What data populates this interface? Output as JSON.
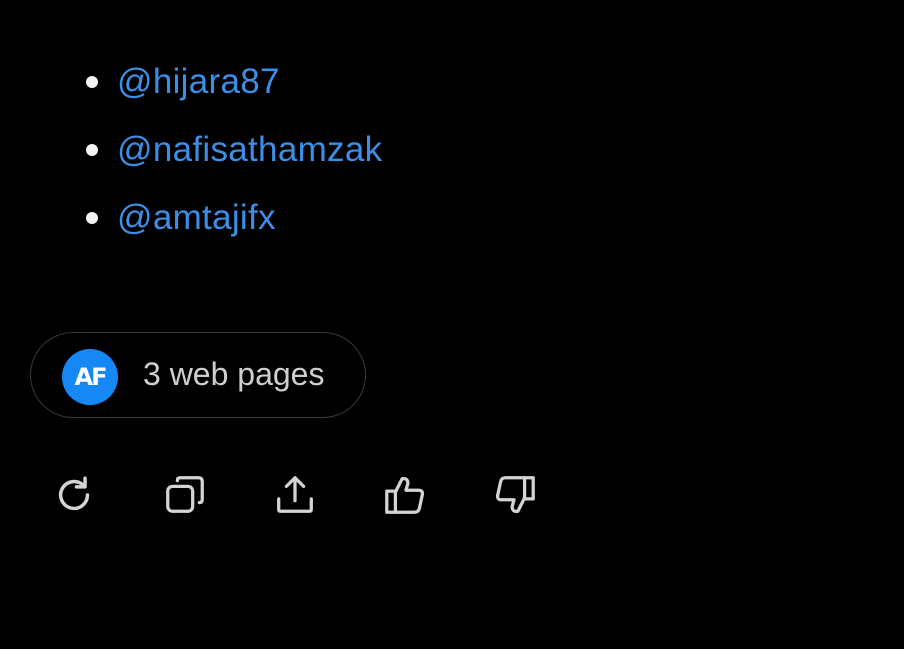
{
  "mentions": [
    {
      "handle": "@hijara87"
    },
    {
      "handle": "@nafisathamzak"
    },
    {
      "handle": "@amtajifx"
    }
  ],
  "sources": {
    "avatar_text": "AF",
    "label": "3 web pages",
    "avatar_color": "#1688f5"
  },
  "actions": [
    {
      "icon": "regenerate-icon"
    },
    {
      "icon": "copy-icon"
    },
    {
      "icon": "share-icon"
    },
    {
      "icon": "thumbs-up-icon"
    },
    {
      "icon": "thumbs-down-icon"
    }
  ],
  "colors": {
    "background": "#000000",
    "link": "#3b8fe6",
    "icon": "#d4d4d4",
    "pill_border": "#3a3a3a"
  }
}
